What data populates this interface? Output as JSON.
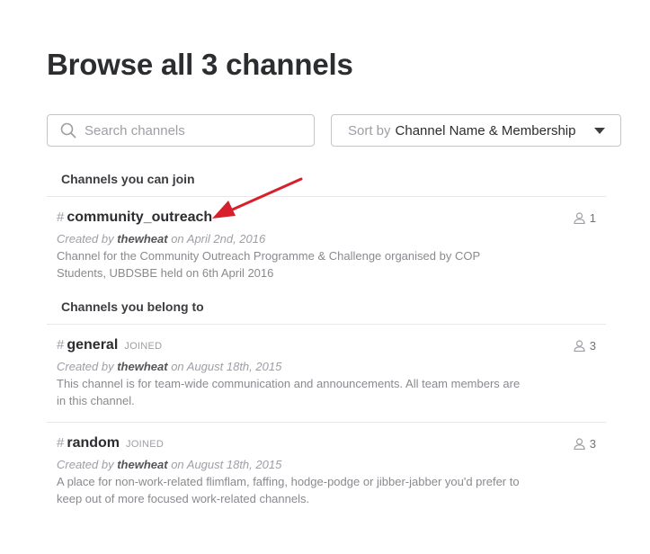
{
  "header": {
    "title": "Browse all 3 channels"
  },
  "search": {
    "placeholder": "Search channels",
    "value": ""
  },
  "sort": {
    "prefix": "Sort by",
    "value": "Channel Name & Membership"
  },
  "sections": {
    "joinable": {
      "label": "Channels you can join",
      "channels": [
        {
          "hash": "#",
          "name": "community_outreach",
          "created_prefix": "Created by",
          "creator": "thewheat",
          "created_suffix": "on April 2nd, 2016",
          "purpose": "Channel for the Community Outreach Programme & Challenge organised by COP Students, UBDSBE held on 6th April 2016",
          "members": "1"
        }
      ]
    },
    "belong": {
      "label": "Channels you belong to",
      "channels": [
        {
          "hash": "#",
          "name": "general",
          "tag": "JOINED",
          "created_prefix": "Created by",
          "creator": "thewheat",
          "created_suffix": "on August 18th, 2015",
          "purpose": "This channel is for team-wide communication and announcements. All team members are in this channel.",
          "members": "3"
        },
        {
          "hash": "#",
          "name": "random",
          "tag": "JOINED",
          "created_prefix": "Created by",
          "creator": "thewheat",
          "created_suffix": "on August 18th, 2015",
          "purpose": "A place for non-work-related flimflam, faffing, hodge-podge or jibber-jabber you'd prefer to keep out of more focused work-related channels.",
          "members": "3"
        }
      ]
    }
  },
  "colors": {
    "annotation_arrow": "#d7202b",
    "text": "#2c2d30",
    "muted": "#9e9ea6"
  },
  "icons": {
    "search": "search-icon",
    "sort": "caret-down-icon",
    "members": "user-icon",
    "annotation": "red-arrow"
  }
}
